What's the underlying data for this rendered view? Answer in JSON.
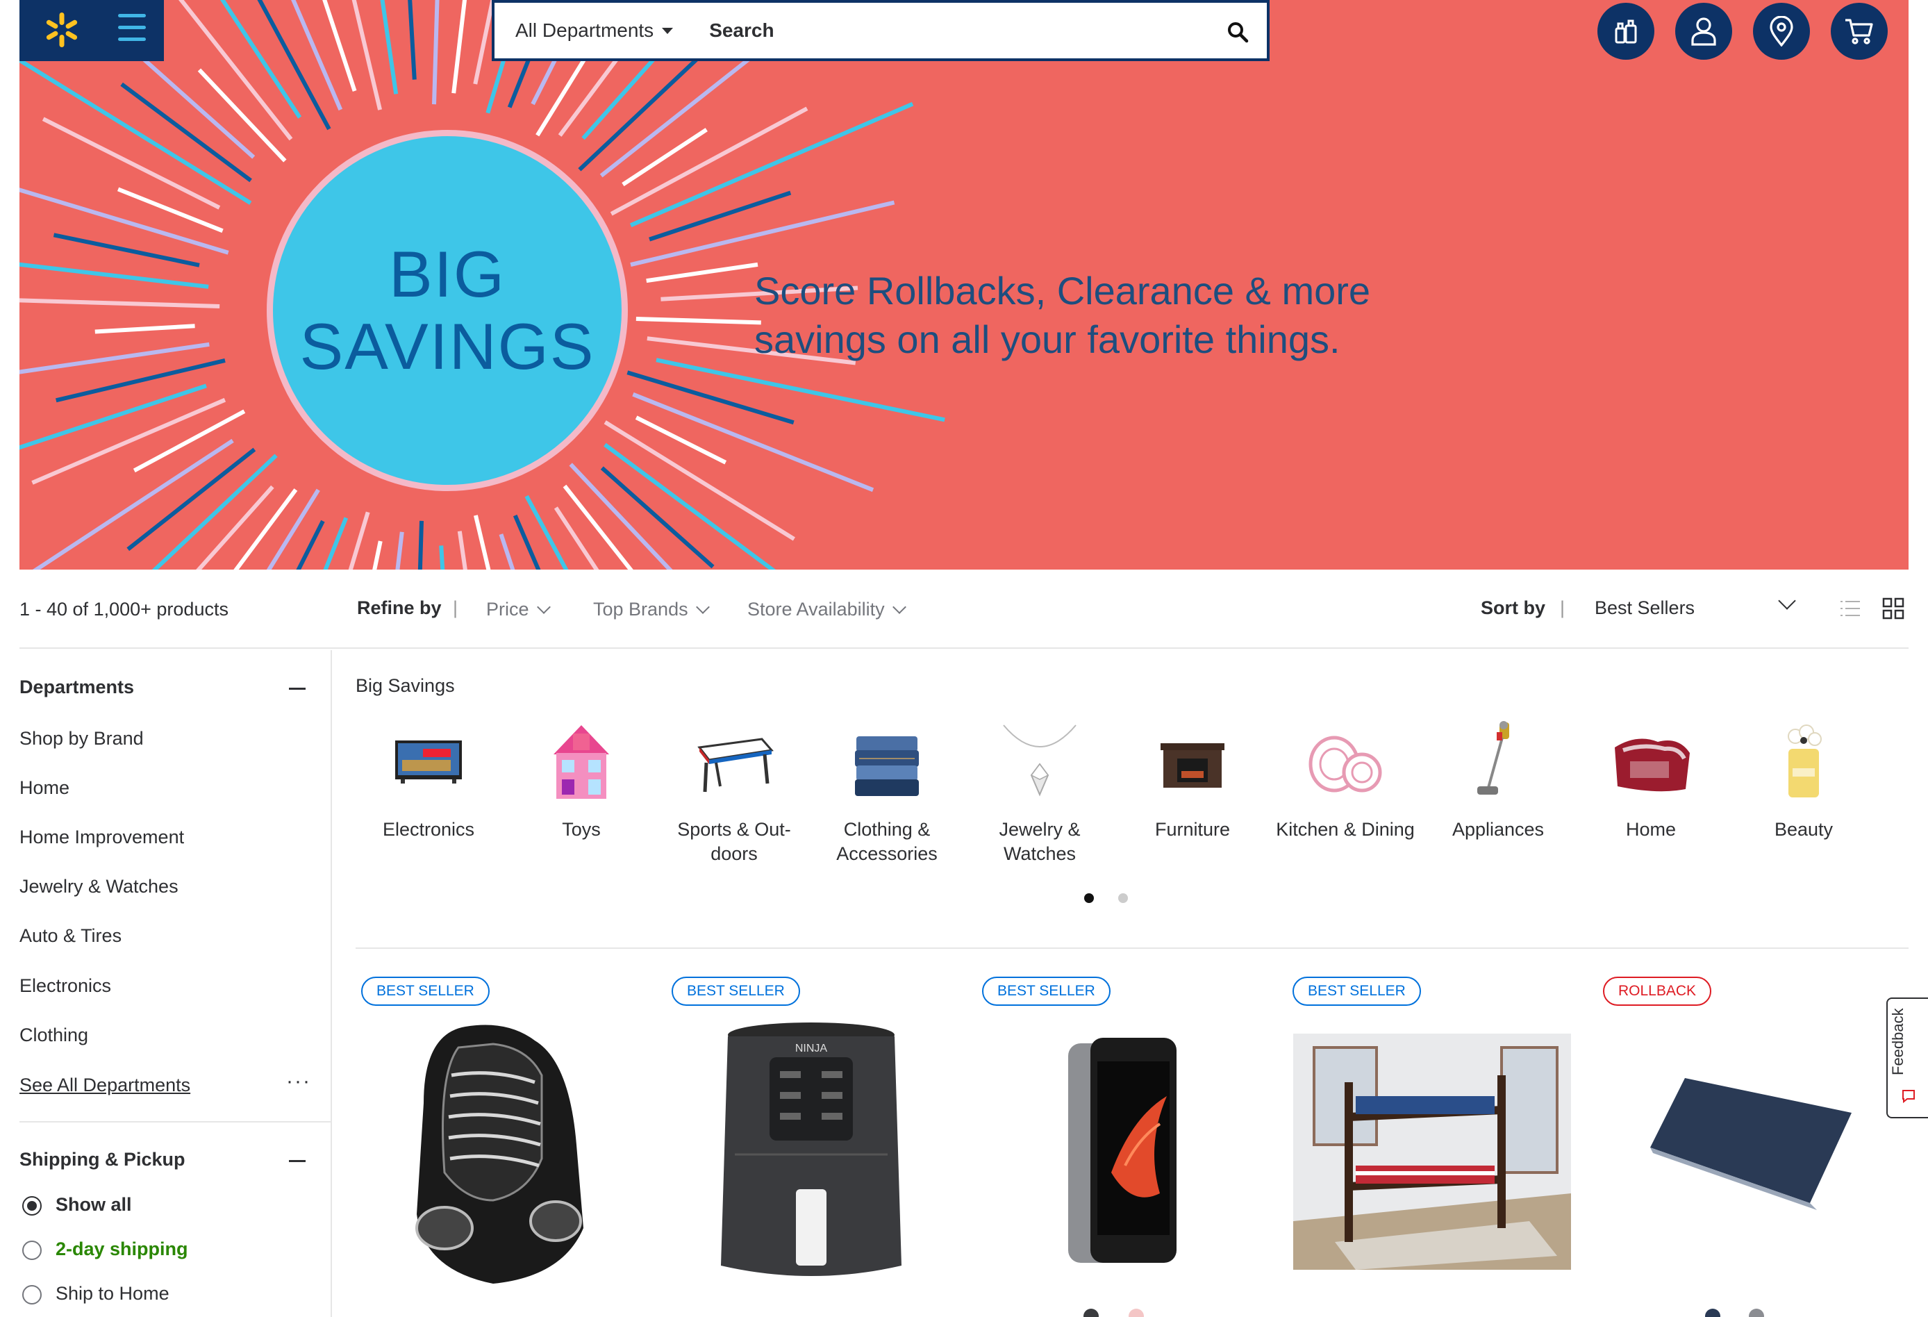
{
  "header": {
    "dept_label": "All Departments",
    "search_text": "Search",
    "icons": [
      "spark-logo-icon",
      "menu-icon",
      "search-icon",
      "reorder-icon",
      "account-icon",
      "store-location-icon",
      "cart-icon"
    ]
  },
  "hero": {
    "line1": "BIG",
    "line2": "SAVINGS",
    "tagline1": "Score Rollbacks, Clearance & more",
    "tagline2": "savings on all your favorite things.",
    "colors": {
      "background": "#ef6660",
      "circle": "#3ec6e8",
      "text": "#1d4e7f"
    }
  },
  "filter_bar": {
    "count": "1 - 40 of 1,000+ products",
    "refine_label": "Refine by",
    "separator": "|",
    "filters": [
      "Price",
      "Top Brands",
      "Store Availability"
    ],
    "sort_label": "Sort by",
    "sort_value": "Best Sellers"
  },
  "sidebar": {
    "departments_title": "Departments",
    "departments": [
      "Shop by Brand",
      "Home",
      "Home Improvement",
      "Jewelry & Watches",
      "Auto & Tires",
      "Electronics",
      "Clothing"
    ],
    "see_all": "See All Departments",
    "more": "···",
    "shipping_title": "Shipping & Pickup",
    "shipping_options": [
      "Show all",
      "2-day shipping",
      "Ship to Home"
    ]
  },
  "categories": {
    "title": "Big Savings",
    "items": [
      {
        "label": "Electronics",
        "icon": "tv-icon"
      },
      {
        "label": "Toys",
        "icon": "dollhouse-icon"
      },
      {
        "label": "Sports & Out-doors",
        "icon": "air-hockey-table-icon"
      },
      {
        "label": "Clothing & Accessories",
        "icon": "jeans-icon"
      },
      {
        "label": "Jewelry & Watches",
        "icon": "pendant-icon"
      },
      {
        "label": "Furniture",
        "icon": "fireplace-icon"
      },
      {
        "label": "Kitchen & Dining",
        "icon": "dinnerware-icon"
      },
      {
        "label": "Appliances",
        "icon": "stick-vacuum-icon"
      },
      {
        "label": "Home",
        "icon": "blanket-icon"
      },
      {
        "label": "Beauty",
        "icon": "perfume-icon"
      }
    ]
  },
  "products": [
    {
      "badge": "BEST SELLER",
      "image": "car-seat-image"
    },
    {
      "badge": "BEST SELLER",
      "image": "air-fryer-image"
    },
    {
      "badge": "BEST SELLER",
      "image": "smartphone-image"
    },
    {
      "badge": "BEST SELLER",
      "image": "bunk-bed-image"
    },
    {
      "badge": "ROLLBACK",
      "image": "laptop-image"
    }
  ],
  "feedback": {
    "label": "Feedback"
  }
}
